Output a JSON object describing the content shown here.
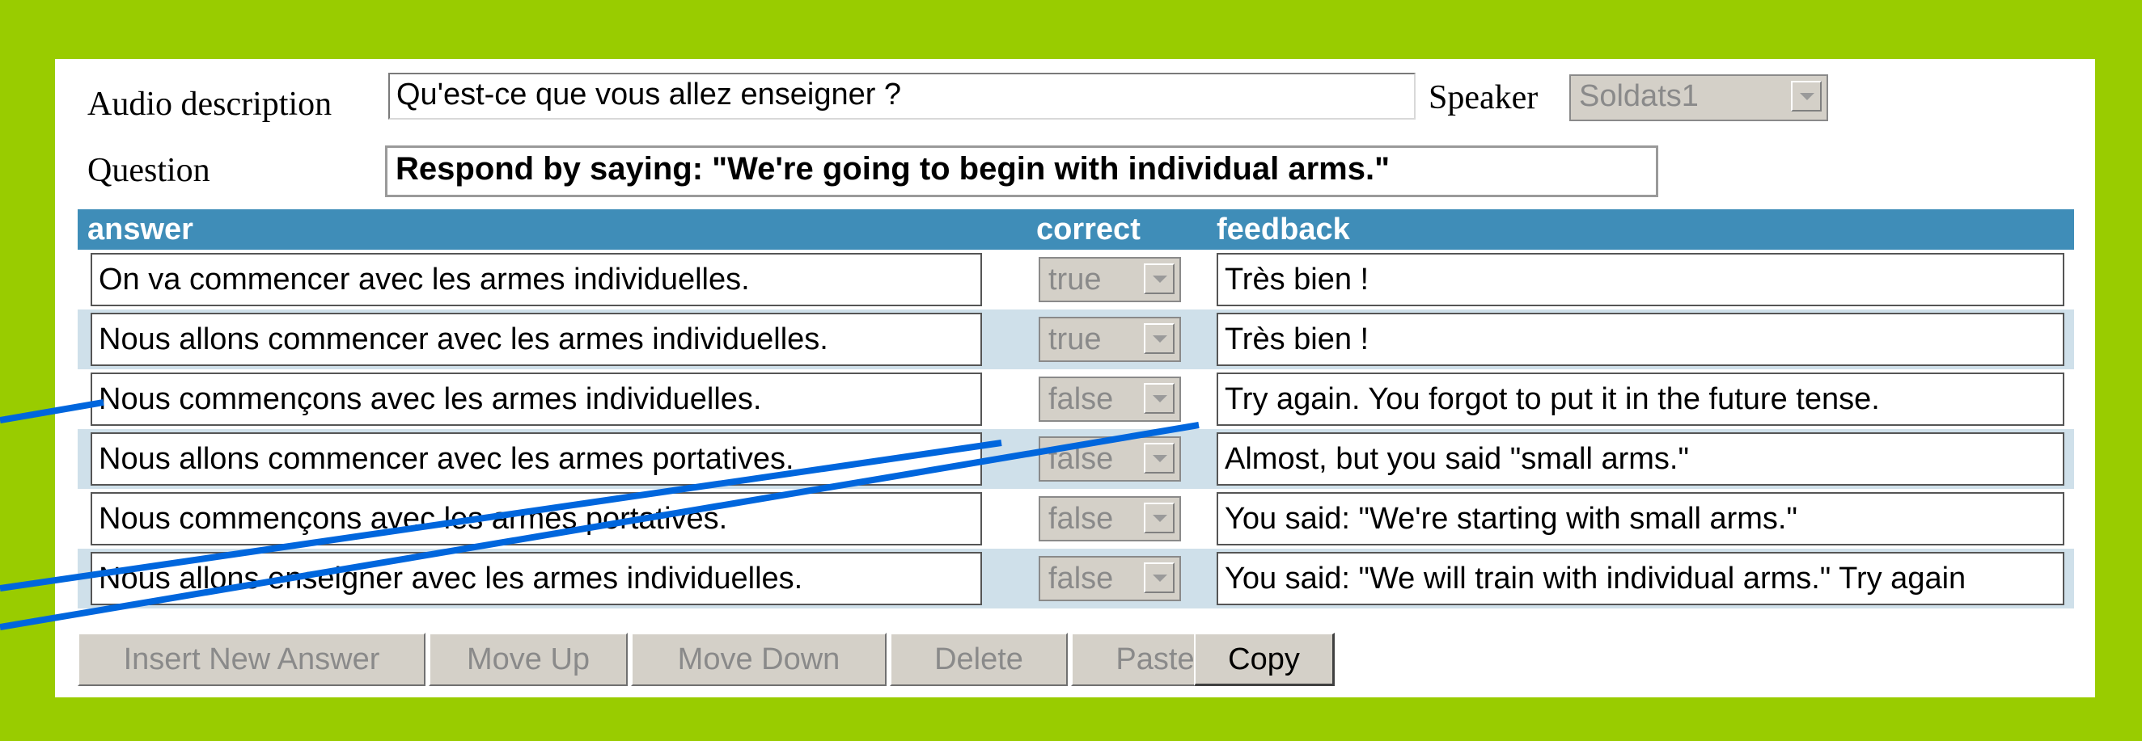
{
  "form": {
    "audio_label": "Audio description",
    "audio_value": "Qu'est-ce que vous allez enseigner ?",
    "speaker_label": "Speaker",
    "speaker_value": "Soldats1",
    "question_label": "Question",
    "question_value": "Respond by saying: \"We're going to begin with individual arms.\""
  },
  "table": {
    "headers": {
      "answer": "answer",
      "correct": "correct",
      "feedback": "feedback"
    },
    "rows": [
      {
        "answer": "On va commencer avec les armes individuelles.",
        "correct": "true",
        "feedback": "Très bien !"
      },
      {
        "answer": "Nous allons commencer avec les armes individuelles.",
        "correct": "true",
        "feedback": "Très bien !"
      },
      {
        "answer": "Nous commençons avec les armes individuelles.",
        "correct": "false",
        "feedback": "Try again. You forgot to put it in the future tense."
      },
      {
        "answer": "Nous allons commencer avec les armes portatives.",
        "correct": "false",
        "feedback": "Almost, but you said \"small arms.\""
      },
      {
        "answer": "Nous commençons avec les armes portatives.",
        "correct": "false",
        "feedback": "You said: \"We're starting with small arms.\""
      },
      {
        "answer": "Nous allons enseigner avec les armes individuelles.",
        "correct": "false",
        "feedback": "You said: \"We will train with individual arms.\" Try again"
      }
    ]
  },
  "buttons": {
    "insert": "Insert New Answer",
    "move_up": "Move Up",
    "move_down": "Move Down",
    "delete": "Delete",
    "paste": "Paste",
    "copy": "Copy"
  },
  "colors": {
    "frame": "#99cc00",
    "header": "#3f8db8",
    "alt_row": "#cfe0ea",
    "callout_line": "#0066dd"
  }
}
